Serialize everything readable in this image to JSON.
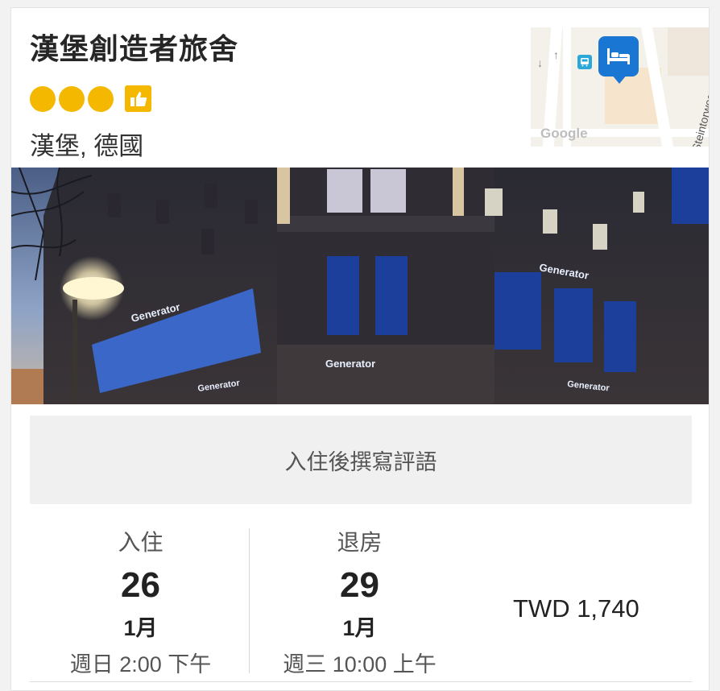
{
  "hotel": {
    "name": "漢堡創造者旅舍",
    "rating_dots": 3,
    "rating_color": "#f5b800",
    "location": "漢堡, 德國",
    "badge_icon": "thumbs-up-icon"
  },
  "map": {
    "street": "Steintorweg",
    "attribution": "Google",
    "pin_icon": "bed-icon",
    "pin_color": "#1976d2",
    "transit_icon": "bus-icon"
  },
  "photo": {
    "signs": [
      "Generator",
      "Generator",
      "Generator",
      "Generator",
      "Generator"
    ]
  },
  "review": {
    "label": "入住後撰寫評語"
  },
  "stay": {
    "checkin": {
      "label": "入住",
      "day": "26",
      "month": "1月",
      "time": "週日 2:00 下午"
    },
    "checkout": {
      "label": "退房",
      "day": "29",
      "month": "1月",
      "time": "週三 10:00 上午"
    },
    "price": "TWD 1,740"
  }
}
